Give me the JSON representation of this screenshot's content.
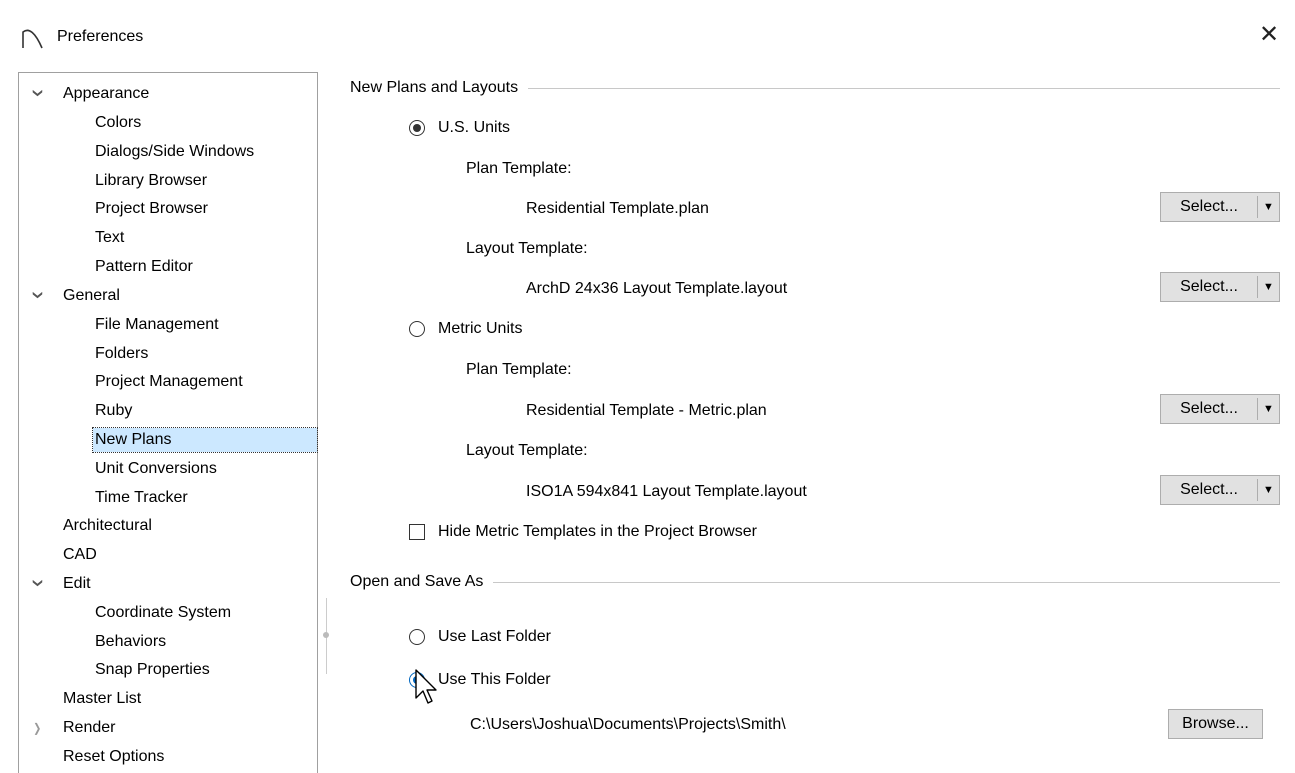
{
  "window": {
    "title": "Preferences",
    "close_label": "✕"
  },
  "sidebar": {
    "items": [
      {
        "label": "Appearance"
      },
      {
        "label": "Colors"
      },
      {
        "label": "Dialogs/Side Windows"
      },
      {
        "label": "Library Browser"
      },
      {
        "label": "Project Browser"
      },
      {
        "label": "Text"
      },
      {
        "label": "Pattern Editor"
      },
      {
        "label": "General"
      },
      {
        "label": "File Management"
      },
      {
        "label": "Folders"
      },
      {
        "label": "Project Management"
      },
      {
        "label": "Ruby"
      },
      {
        "label": "New Plans"
      },
      {
        "label": "Unit Conversions"
      },
      {
        "label": "Time Tracker"
      },
      {
        "label": "Architectural"
      },
      {
        "label": "CAD"
      },
      {
        "label": "Edit"
      },
      {
        "label": "Coordinate System"
      },
      {
        "label": "Behaviors"
      },
      {
        "label": "Snap Properties"
      },
      {
        "label": "Master List"
      },
      {
        "label": "Render"
      },
      {
        "label": "Reset Options"
      }
    ],
    "selected": "New Plans"
  },
  "new_plans": {
    "group_title": "New Plans and Layouts",
    "us_units": {
      "label": "U.S. Units",
      "checked": true,
      "plan_template_label": "Plan Template:",
      "plan_template_value": "Residential Template.plan",
      "layout_template_label": "Layout Template:",
      "layout_template_value": "ArchD 24x36 Layout Template.layout"
    },
    "metric_units": {
      "label": "Metric Units",
      "checked": false,
      "plan_template_label": "Plan Template:",
      "plan_template_value": "Residential Template - Metric.plan",
      "layout_template_label": "Layout Template:",
      "layout_template_value": "ISO1A 594x841 Layout Template.layout"
    },
    "select_label": "Select...",
    "hide_metric_label": "Hide Metric Templates in the Project Browser",
    "hide_metric_checked": false
  },
  "open_save": {
    "group_title": "Open and Save As",
    "use_last_label": "Use Last Folder",
    "use_this_label": "Use This Folder",
    "selected": "Use This Folder",
    "folder_path": "C:\\Users\\Joshua\\Documents\\Projects\\Smith\\",
    "browse_label": "Browse..."
  },
  "colors": {
    "selection_bg": "#cce8ff",
    "radio_accent": "#0067c0",
    "button_bg": "#e1e1e1"
  }
}
